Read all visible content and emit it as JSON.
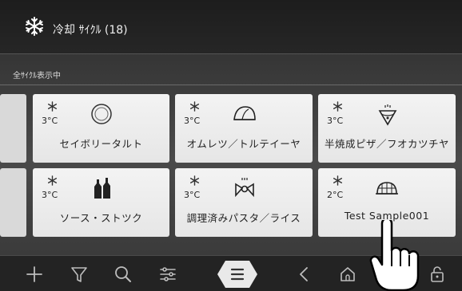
{
  "header": {
    "title": "冷却 ｻｲｸﾙ (18)",
    "icon": "snowflake-icon"
  },
  "filter": {
    "label": "全ｻｲｸﾙ表示中"
  },
  "cards": [
    {
      "temp": "3°C",
      "name": "セイボリータルト",
      "icon": "tart-icon"
    },
    {
      "temp": "3°C",
      "name": "オムレツ／トルテイーヤ",
      "icon": "omelette-icon"
    },
    {
      "temp": "3°C",
      "name": "半焼成ピザ／フオカツチヤ",
      "icon": "pizza-icon"
    },
    {
      "temp": "3°C",
      "name": "ソース・ストツク",
      "icon": "bottles-icon"
    },
    {
      "temp": "3°C",
      "name": "調理済みパスタ／ライス",
      "icon": "pasta-icon"
    },
    {
      "temp": "2°C",
      "name": "Test Sample001",
      "icon": "grid-dome-icon"
    }
  ],
  "navbar": {
    "items": [
      "add-icon",
      "filter-icon",
      "search-icon",
      "settings-icon",
      "menu-icon",
      "back-icon",
      "home-icon",
      "lock-icon"
    ]
  },
  "colors": {
    "card_bg": "#eeeeee",
    "header_bg": "#1f1f1f",
    "menu_button": "#e9e9e9"
  }
}
